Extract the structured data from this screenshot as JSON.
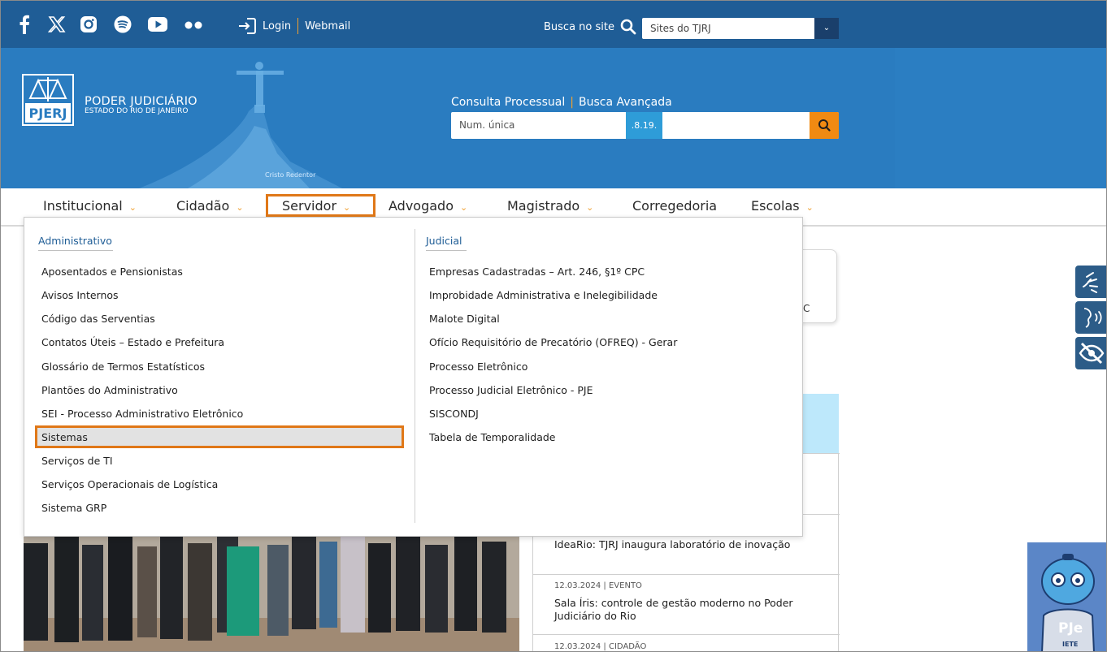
{
  "topbar": {
    "social": [
      "facebook-icon",
      "x-icon",
      "instagram-icon",
      "spotify-icon",
      "youtube-icon",
      "flickr-icon"
    ],
    "login_label": "Login",
    "webmail_label": "Webmail",
    "search_site_label": "Busca no site",
    "sites_select_value": "Sites do TJRJ"
  },
  "header": {
    "logo_abbr": "PJERJ",
    "logo_title": "PODER JUDICIÁRIO",
    "logo_subtitle": "ESTADO DO RIO DE JANEIRO",
    "cristo_label": "Cristo Redentor",
    "consulta_label": "Consulta Processual",
    "busca_avancada_label": "Busca Avançada",
    "process_placeholder": "Num. única",
    "process_code": ".8.19."
  },
  "nav": {
    "items": [
      {
        "label": "Institucional",
        "chevron": true
      },
      {
        "label": "Cidadão",
        "chevron": true
      },
      {
        "label": "Servidor",
        "chevron": true
      },
      {
        "label": "Advogado",
        "chevron": true
      },
      {
        "label": "Magistrado",
        "chevron": true
      },
      {
        "label": "Corregedoria",
        "chevron": false
      },
      {
        "label": "Escolas",
        "chevron": true
      }
    ]
  },
  "dropdown": {
    "administrativo": {
      "heading": "Administrativo",
      "links": [
        "Aposentados e Pensionistas",
        "Avisos Internos",
        "Código das Serventias",
        "Contatos Úteis – Estado e Prefeitura",
        "Glossário de Termos Estatísticos",
        "Plantões do Administrativo",
        "SEI - Processo Administrativo Eletrônico",
        "Sistemas",
        "Serviços de TI",
        "Serviços Operacionais de Logística",
        "Sistema GRP"
      ]
    },
    "judicial": {
      "heading": "Judicial",
      "links": [
        "Empresas Cadastradas – Art. 246, §1º CPC",
        "Improbidade Administrativa e Inelegibilidade",
        "Malote Digital",
        "Ofício Requisitório de Precatório (OFREQ) - Gerar",
        "Processo Eletrônico",
        "Processo Judicial Eletrônico - PJE",
        "SISCONDJ",
        "Tabela de Temporalidade"
      ]
    }
  },
  "side": {
    "card_fragment": "C"
  },
  "news": [
    {
      "meta": "",
      "title": "IdeaRio: TJRJ inaugura laboratório de inovação"
    },
    {
      "meta": "12.03.2024 | EVENTO",
      "title": "Sala Íris: controle de gestão moderno no Poder Judiciário do Rio"
    },
    {
      "meta": "12.03.2024 | CIDADÃO",
      "title": ""
    }
  ],
  "pje": {
    "label": "PJe",
    "sublabel": "IETE"
  },
  "colors": {
    "topbar": "#1f5d96",
    "header": "#2a7cc0",
    "accent": "#f08a12",
    "highlight": "#e07818"
  }
}
